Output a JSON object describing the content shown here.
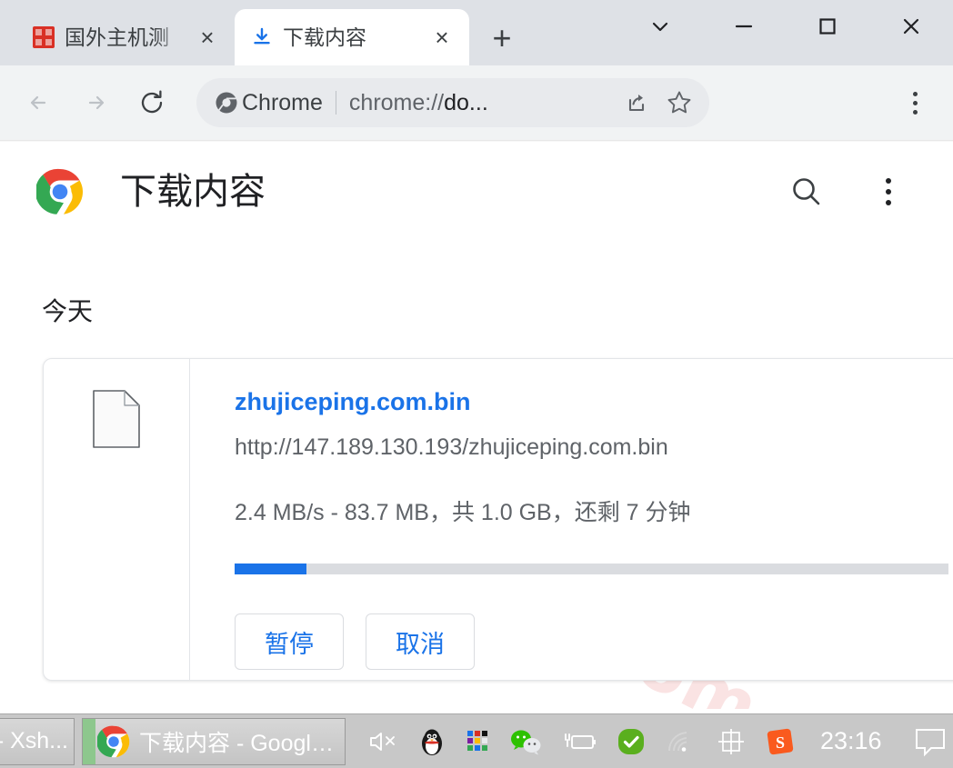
{
  "window": {
    "controls": [
      {
        "name": "tab-search-chevron",
        "glyph": "chevron-down-icon"
      },
      {
        "name": "minimize",
        "glyph": "minimize-icon"
      },
      {
        "name": "maximize",
        "glyph": "maximize-icon"
      },
      {
        "name": "close",
        "glyph": "close-icon"
      }
    ]
  },
  "tabs": [
    {
      "title": "国外主机测",
      "favicon": "red-site-icon",
      "active": false,
      "close_label": "×"
    },
    {
      "title": "下载内容",
      "favicon": "download-icon",
      "active": true,
      "close_label": "×"
    }
  ],
  "newtab": {
    "label": "+"
  },
  "toolbar": {
    "back": "back-arrow-icon",
    "forward": "forward-arrow-icon",
    "reload": "reload-icon",
    "omnibox": {
      "brand": "Chrome",
      "url_plain": "chrome://",
      "url_bold": "do...",
      "site_icon": "chrome-shield-icon",
      "share_icon": "share-icon",
      "bookmark_icon": "star-icon"
    },
    "menu": "three-dot-menu-icon"
  },
  "page": {
    "watermark": "zhujiceping.com",
    "title": "下载内容",
    "logo": "chrome-logo",
    "search_icon": "search-icon",
    "more_icon": "three-dot-menu-icon",
    "day_label": "今天",
    "download": {
      "file_icon": "generic-file-icon",
      "filename": "zhujiceping.com.bin",
      "url": "http://147.189.130.193/zhujiceping.com.bin",
      "status": "2.4 MB/s - 83.7 MB，共 1.0 GB，还剩 7 分钟",
      "progress_percent": 10,
      "buttons": [
        {
          "label": "暂停",
          "name": "pause-button"
        },
        {
          "label": "取消",
          "name": "cancel-button"
        }
      ]
    }
  },
  "taskbar": {
    "items": [
      {
        "label": "- Xsh...",
        "name": "taskbar-item-xshell"
      },
      {
        "label": "下载内容 - Google ...",
        "name": "taskbar-item-chrome"
      }
    ],
    "tray": [
      {
        "name": "volume-muted-icon"
      },
      {
        "name": "qq-penguin-icon"
      },
      {
        "name": "color-grid-icon"
      },
      {
        "name": "wechat-icon"
      },
      {
        "name": "battery-charging-icon"
      },
      {
        "name": "green-check-icon"
      },
      {
        "name": "wifi-icon"
      },
      {
        "name": "ime-chinese-icon",
        "glyph": "中"
      },
      {
        "name": "sogou-icon",
        "glyph": "S"
      }
    ],
    "clock": "23:16",
    "notification_icon": "notification-icon"
  },
  "colors": {
    "accent_blue": "#1a73e8",
    "tabstrip": "#dee1e6",
    "toolbar": "#f1f3f4",
    "omnibox": "#e8eaed",
    "watermark": "#fae3e3",
    "taskbar": "#c8c8c8"
  }
}
